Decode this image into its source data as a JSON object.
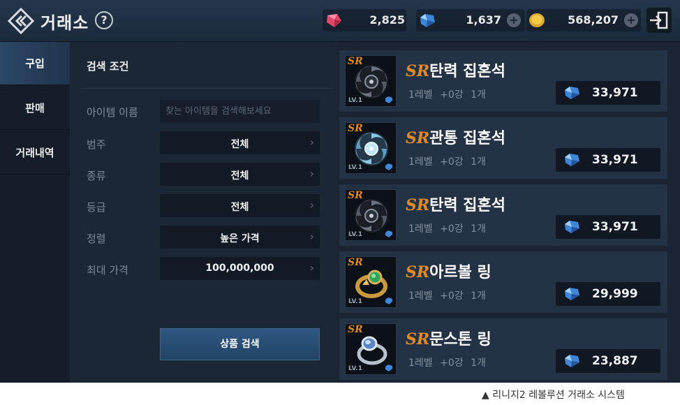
{
  "header": {
    "title": "거래소",
    "help_label": "?",
    "currencies": [
      {
        "icon": "red-gem-icon",
        "value": "2,825"
      },
      {
        "icon": "blue-diamond-icon",
        "value": "1,637"
      },
      {
        "icon": "gold-coin-icon",
        "value": "568,207"
      }
    ]
  },
  "tabs": [
    {
      "label": "구입",
      "active": true
    },
    {
      "label": "판매",
      "active": false
    },
    {
      "label": "거래내역",
      "active": false
    }
  ],
  "search": {
    "title": "검색 조건",
    "name_label": "아이템 이름",
    "name_placeholder": "찾는 아이템을 검색해보세요",
    "fields": [
      {
        "label": "범주",
        "value": "전체"
      },
      {
        "label": "종류",
        "value": "전체"
      },
      {
        "label": "등급",
        "value": "전체"
      },
      {
        "label": "정렬",
        "value": "높은 가격"
      },
      {
        "label": "최대 가격",
        "value": "100,000,000"
      }
    ],
    "button_label": "상품 검색"
  },
  "items": [
    {
      "grade": "SR",
      "name": "탄력 집혼석",
      "level": "1레벨",
      "enhance": "+0강",
      "qty": "1개",
      "price": "33,971",
      "thumb_grade": "SR",
      "thumb_level": "LV.1",
      "art": "dark-orb"
    },
    {
      "grade": "SR",
      "name": "관통 집혼석",
      "level": "1레벨",
      "enhance": "+0강",
      "qty": "1개",
      "price": "33,971",
      "thumb_grade": "SR",
      "thumb_level": "LV.1",
      "art": "light-orb"
    },
    {
      "grade": "SR",
      "name": "탄력 집혼석",
      "level": "1레벨",
      "enhance": "+0강",
      "qty": "1개",
      "price": "33,971",
      "thumb_grade": "SR",
      "thumb_level": "LV.1",
      "art": "dark-orb"
    },
    {
      "grade": "SR",
      "name": "아르볼 링",
      "level": "1레벨",
      "enhance": "+0강",
      "qty": "1개",
      "price": "29,999",
      "thumb_grade": "SR",
      "thumb_level": "LV.1",
      "art": "gold-ring"
    },
    {
      "grade": "SR",
      "name": "문스톤 링",
      "level": "1레벨",
      "enhance": "+0강",
      "qty": "1개",
      "price": "23,887",
      "thumb_grade": "SR",
      "thumb_level": "LV.1",
      "art": "silver-ring"
    }
  ],
  "caption": "▲ 리니지2 레볼루션 거래소 시스템",
  "colors": {
    "sr_grade": "#e08a2a",
    "active_tab": "#2c4767",
    "background": "#1a2433"
  }
}
